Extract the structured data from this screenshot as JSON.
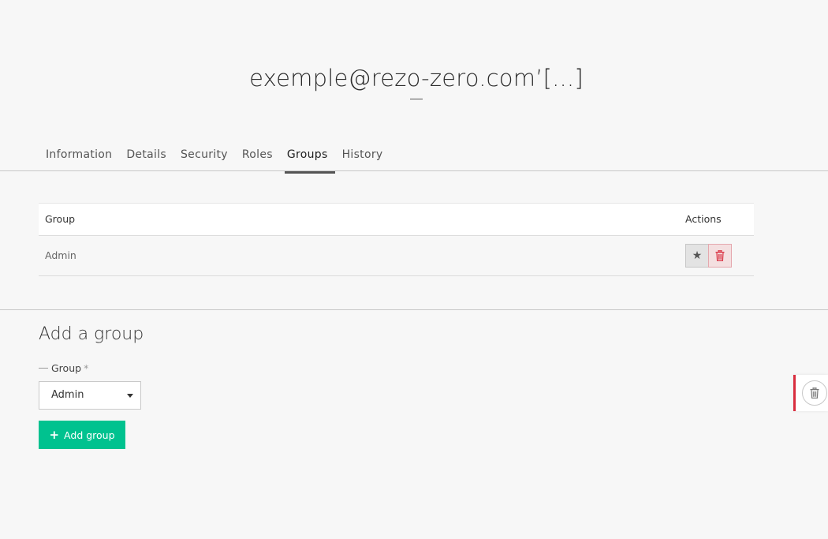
{
  "page": {
    "title": "exemple@rezo-zero.com’[...]"
  },
  "tabs": [
    {
      "label": "Information"
    },
    {
      "label": "Details"
    },
    {
      "label": "Security"
    },
    {
      "label": "Roles"
    },
    {
      "label": "Groups",
      "active": true
    },
    {
      "label": "History"
    }
  ],
  "table": {
    "headers": {
      "group": "Group",
      "actions": "Actions"
    },
    "rows": [
      {
        "group": "Admin"
      }
    ]
  },
  "add_group": {
    "title": "Add a group",
    "field_label": "Group",
    "required_mark": "*",
    "select_value": "Admin",
    "button_label": "Add group"
  },
  "colors": {
    "accent": "#00c28f",
    "danger": "#d92d3e"
  }
}
